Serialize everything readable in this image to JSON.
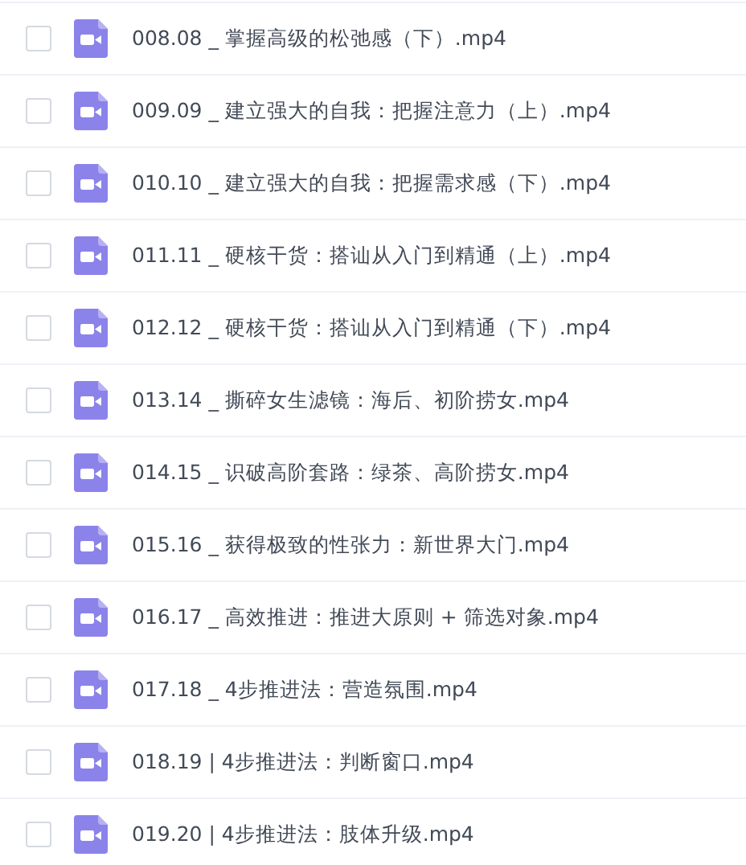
{
  "files": [
    {
      "name": "008.08 _ 掌握高级的松弛感（下）.mp4",
      "checked": false
    },
    {
      "name": "009.09 _ 建立强大的自我：把握注意力（上）.mp4",
      "checked": false
    },
    {
      "name": "010.10 _ 建立强大的自我：把握需求感（下）.mp4",
      "checked": false
    },
    {
      "name": "011.11 _ 硬核干货：搭讪从入门到精通（上）.mp4",
      "checked": false
    },
    {
      "name": "012.12 _ 硬核干货：搭讪从入门到精通（下）.mp4",
      "checked": false
    },
    {
      "name": "013.14 _ 撕碎女生滤镜：海后、初阶捞女.mp4",
      "checked": false
    },
    {
      "name": "014.15 _ 识破高阶套路：绿茶、高阶捞女.mp4",
      "checked": false
    },
    {
      "name": "015.16 _ 获得极致的性张力：新世界大门.mp4",
      "checked": false
    },
    {
      "name": "016.17 _ 高效推进：推进大原则 + 筛选对象.mp4",
      "checked": false
    },
    {
      "name": "017.18 _ 4步推进法：营造氛围.mp4",
      "checked": false
    },
    {
      "name": "018.19 | 4步推进法：判断窗口.mp4",
      "checked": false
    },
    {
      "name": "019.20 | 4步推进法：肢体升级.mp4",
      "checked": false
    }
  ]
}
